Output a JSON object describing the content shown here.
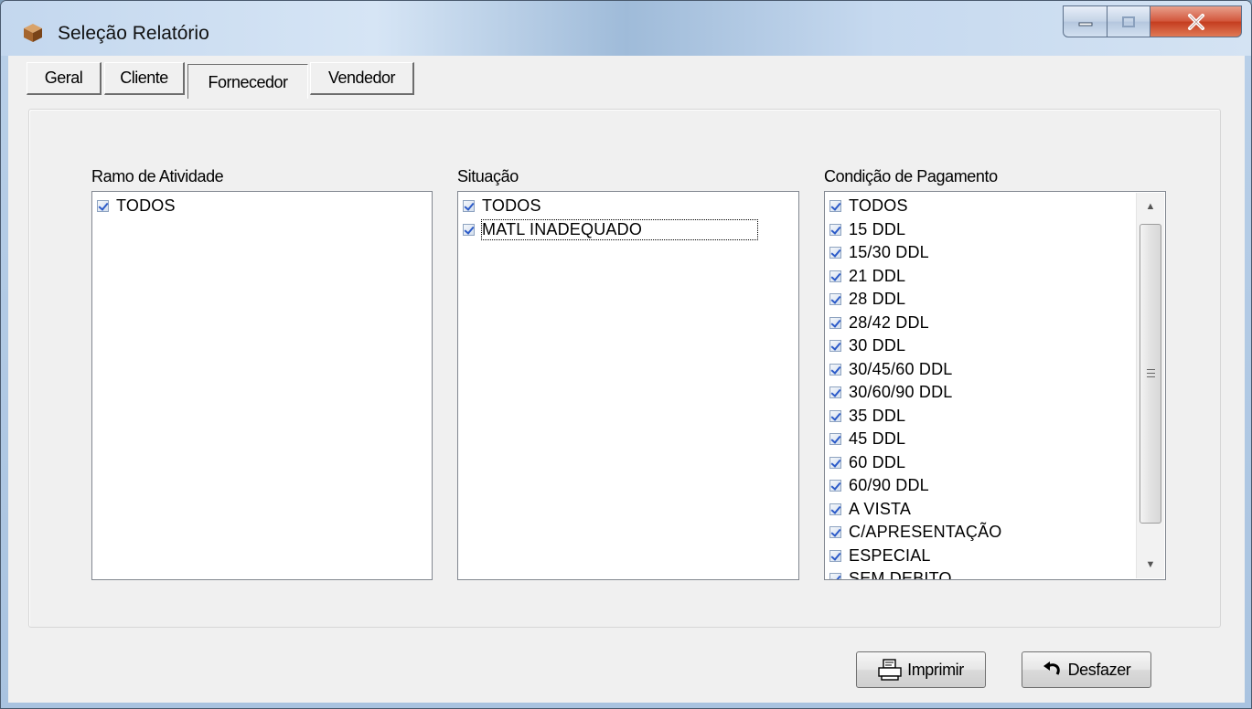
{
  "window": {
    "title": "Seleção Relatório",
    "title_icon": "box-icon"
  },
  "tabs": [
    {
      "label": "Geral",
      "active": false
    },
    {
      "label": "Cliente",
      "active": false
    },
    {
      "label": "Fornecedor",
      "active": true
    },
    {
      "label": "Vendedor",
      "active": false
    }
  ],
  "panels": {
    "ramo": {
      "label": "Ramo de Atividade",
      "items": [
        "TODOS"
      ]
    },
    "situacao": {
      "label": "Situação",
      "items": [
        "TODOS",
        "MATL INADEQUADO"
      ]
    },
    "condicao": {
      "label": "Condição de Pagamento",
      "items": [
        "TODOS",
        "15 DDL",
        "15/30 DDL",
        "21 DDL",
        "28 DDL",
        "28/42 DDL",
        "30 DDL",
        "30/45/60 DDL",
        "30/60/90 DDL",
        "35 DDL",
        "45 DDL",
        "60 DDL",
        "60/90 DDL",
        "A VISTA",
        "C/APRESENTAÇÃO",
        "ESPECIAL",
        "SEM DEBITO"
      ]
    }
  },
  "buttons": {
    "print": "Imprimir",
    "undo": "Desfazer"
  },
  "colors": {
    "checkmark": "#2c5bc8",
    "close_button": "#c43b1e"
  }
}
